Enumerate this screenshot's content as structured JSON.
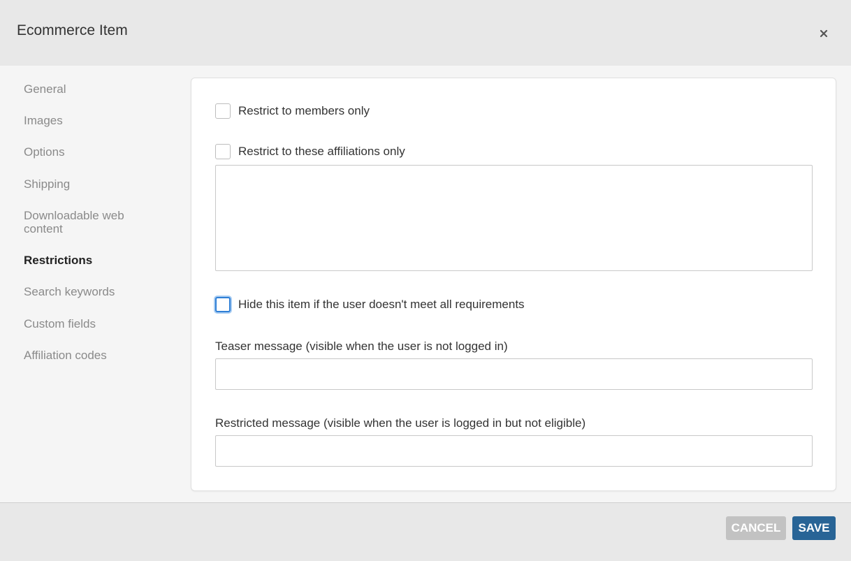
{
  "header": {
    "title": "Ecommerce Item"
  },
  "sidebar": {
    "items": [
      {
        "label": "General"
      },
      {
        "label": "Images"
      },
      {
        "label": "Options"
      },
      {
        "label": "Shipping"
      },
      {
        "label": "Downloadable web content"
      },
      {
        "label": "Restrictions",
        "active": true
      },
      {
        "label": "Search keywords"
      },
      {
        "label": "Custom fields"
      },
      {
        "label": "Affiliation codes"
      }
    ]
  },
  "restrictions": {
    "members_only": {
      "label": "Restrict to members only",
      "checked": false
    },
    "affiliations_only": {
      "label": "Restrict to these affiliations only",
      "checked": false
    },
    "affiliations_value": "",
    "hide_item": {
      "label": "Hide this item if the user doesn't meet all requirements",
      "checked": false
    },
    "teaser": {
      "label": "Teaser message (visible when the user is not logged in)",
      "value": ""
    },
    "restricted": {
      "label": "Restricted message (visible when the user is logged in but not eligible)",
      "value": ""
    }
  },
  "footer": {
    "cancel_label": "CANCEL",
    "save_label": "SAVE"
  },
  "colors": {
    "accent": "#286496",
    "focus": "#2f7fd6",
    "cancel": "#c2c2c2"
  }
}
